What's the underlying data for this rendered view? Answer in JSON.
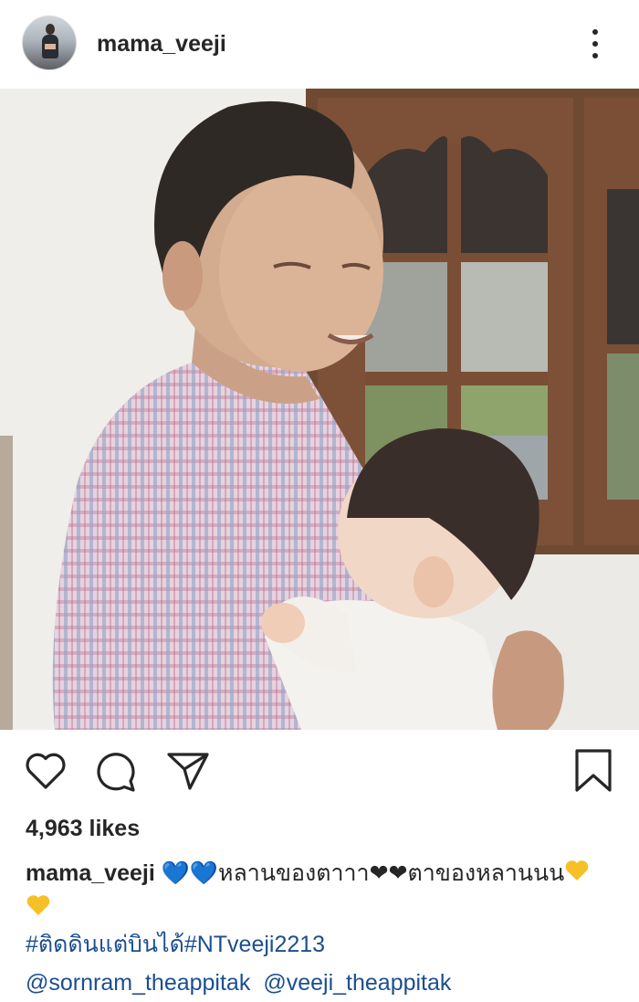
{
  "post": {
    "username": "mama_veeji",
    "likes": "4,963 likes",
    "caption": {
      "username": "mama_veeji",
      "blue_hearts": "💙💙",
      "text_1": "หลานของตาาา",
      "black_hearts": "❤❤",
      "text_2": "ตาของหลานนน"
    },
    "hashtags": "#ติดดินแต่บินได้#NTveeji2213",
    "mentions": [
      "@sornram_theappitak",
      "@veeji_theappitak"
    ]
  },
  "colors": {
    "text": "#262626",
    "link": "#1b4f8f",
    "blue_heart": "#2f7fd1",
    "yellow_heart": "#f6c026"
  },
  "icons": [
    "more-options-icon",
    "heart-icon",
    "comment-icon",
    "share-icon",
    "bookmark-icon"
  ]
}
